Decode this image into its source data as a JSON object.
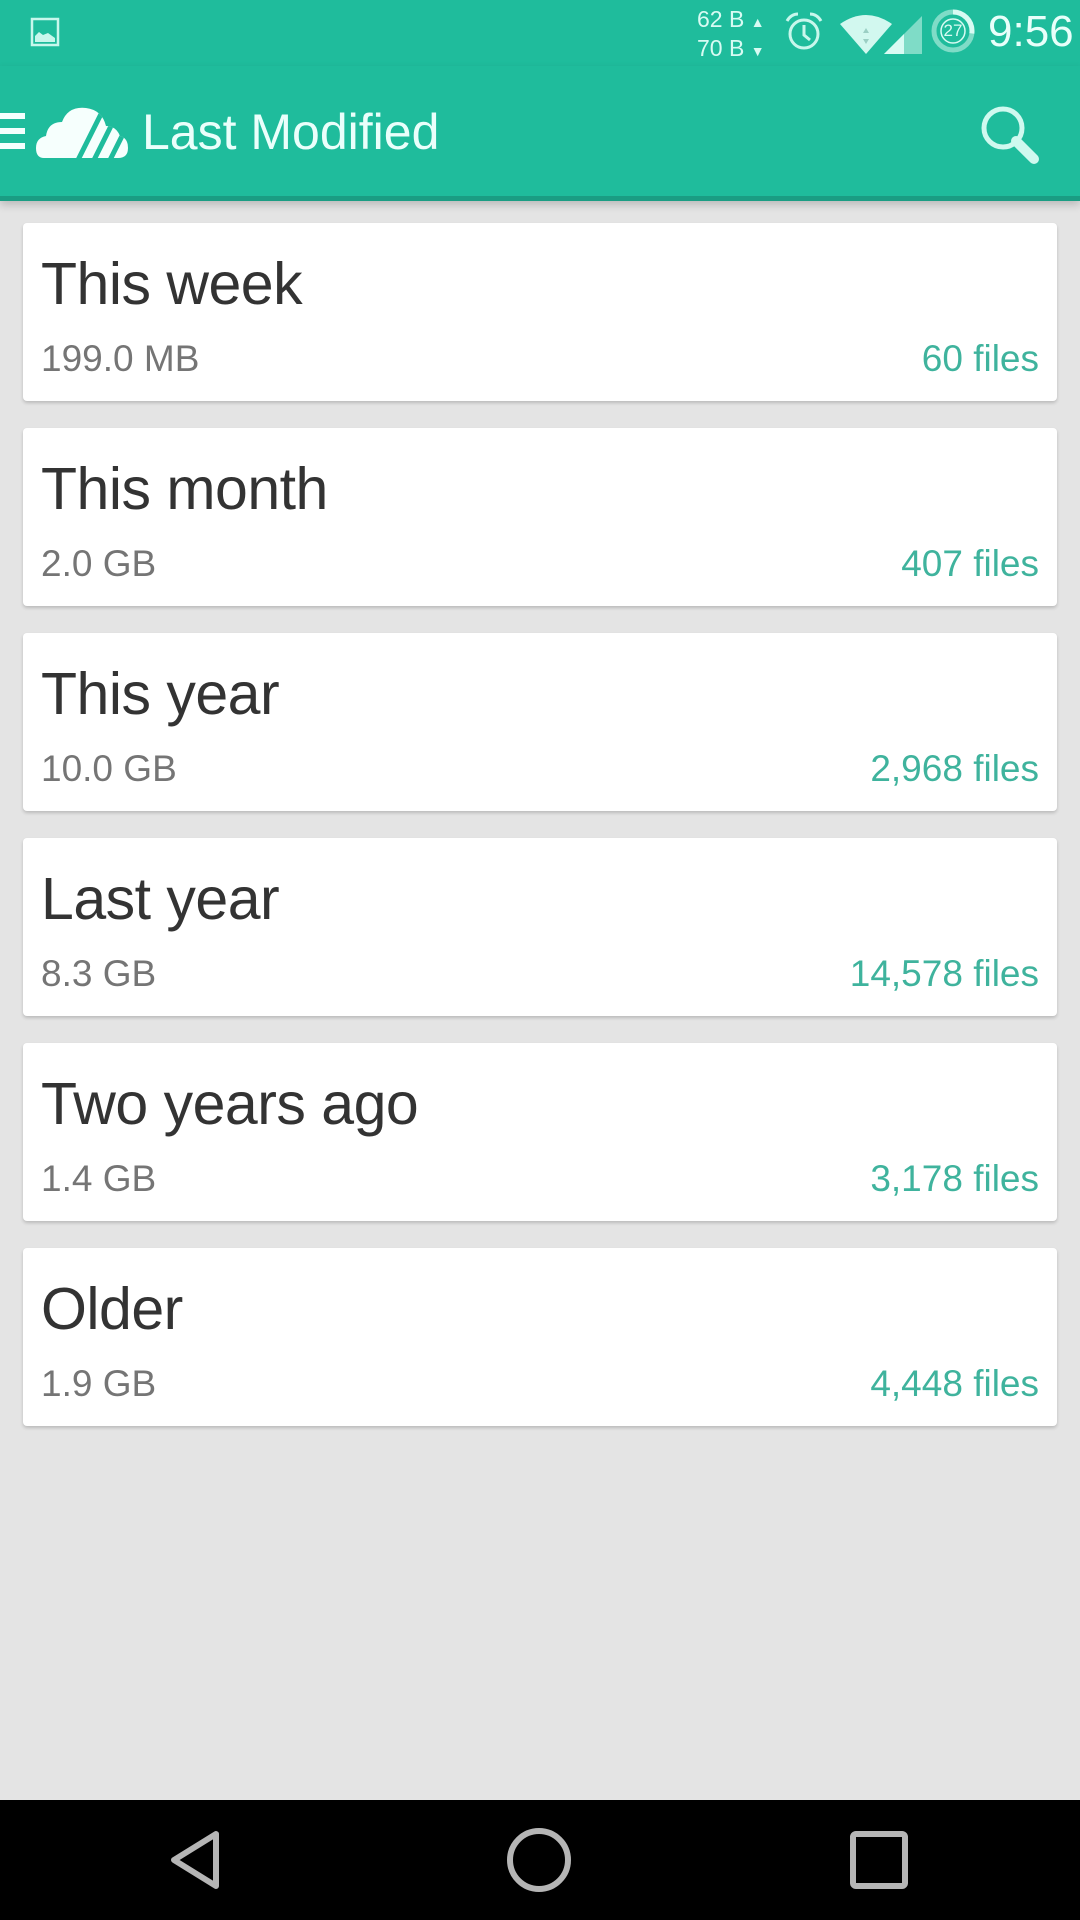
{
  "status_bar": {
    "upload_rate": "62 B",
    "download_rate": "70 B",
    "battery_level": "27",
    "battery_fraction": 0.27,
    "time": "9:56",
    "icons": [
      "gallery-icon",
      "upload-arrow-icon",
      "download-arrow-icon",
      "alarm-icon",
      "wifi-icon",
      "cell-signal-icon",
      "battery-ring-icon"
    ]
  },
  "app_bar": {
    "title": "Last Modified",
    "menu_icon": "hamburger-menu-icon",
    "logo_icon": "cloud-logo-icon",
    "search_icon": "search-icon"
  },
  "colors": {
    "primary": "#1fbc9c",
    "primary_dark": "#1a9d83",
    "accent_text": "#3fb39d",
    "background": "#e4e4e4"
  },
  "groups": [
    {
      "title": "This week",
      "size": "199.0 MB",
      "count": "60 files"
    },
    {
      "title": "This month",
      "size": "2.0 GB",
      "count": "407 files"
    },
    {
      "title": "This year",
      "size": "10.0 GB",
      "count": "2,968 files"
    },
    {
      "title": "Last year",
      "size": "8.3 GB",
      "count": "14,578 files"
    },
    {
      "title": "Two years ago",
      "size": "1.4 GB",
      "count": "3,178 files"
    },
    {
      "title": "Older",
      "size": "1.9 GB",
      "count": "4,448 files"
    }
  ],
  "nav_bar": {
    "icons": [
      "back-icon",
      "home-icon",
      "recents-icon"
    ]
  }
}
